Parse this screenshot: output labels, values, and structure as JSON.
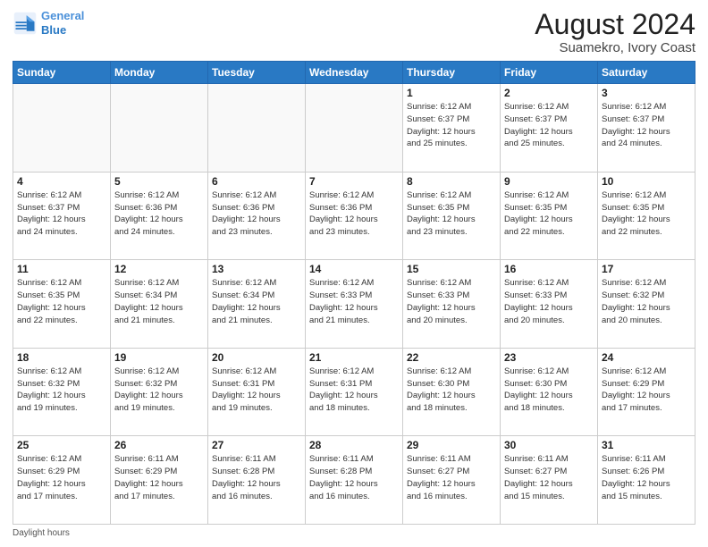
{
  "header": {
    "logo_line1": "General",
    "logo_line2": "Blue",
    "title": "August 2024",
    "subtitle": "Suamekro, Ivory Coast"
  },
  "days_of_week": [
    "Sunday",
    "Monday",
    "Tuesday",
    "Wednesday",
    "Thursday",
    "Friday",
    "Saturday"
  ],
  "weeks": [
    [
      {
        "day": "",
        "info": ""
      },
      {
        "day": "",
        "info": ""
      },
      {
        "day": "",
        "info": ""
      },
      {
        "day": "",
        "info": ""
      },
      {
        "day": "1",
        "info": "Sunrise: 6:12 AM\nSunset: 6:37 PM\nDaylight: 12 hours\nand 25 minutes."
      },
      {
        "day": "2",
        "info": "Sunrise: 6:12 AM\nSunset: 6:37 PM\nDaylight: 12 hours\nand 25 minutes."
      },
      {
        "day": "3",
        "info": "Sunrise: 6:12 AM\nSunset: 6:37 PM\nDaylight: 12 hours\nand 24 minutes."
      }
    ],
    [
      {
        "day": "4",
        "info": "Sunrise: 6:12 AM\nSunset: 6:37 PM\nDaylight: 12 hours\nand 24 minutes."
      },
      {
        "day": "5",
        "info": "Sunrise: 6:12 AM\nSunset: 6:36 PM\nDaylight: 12 hours\nand 24 minutes."
      },
      {
        "day": "6",
        "info": "Sunrise: 6:12 AM\nSunset: 6:36 PM\nDaylight: 12 hours\nand 23 minutes."
      },
      {
        "day": "7",
        "info": "Sunrise: 6:12 AM\nSunset: 6:36 PM\nDaylight: 12 hours\nand 23 minutes."
      },
      {
        "day": "8",
        "info": "Sunrise: 6:12 AM\nSunset: 6:35 PM\nDaylight: 12 hours\nand 23 minutes."
      },
      {
        "day": "9",
        "info": "Sunrise: 6:12 AM\nSunset: 6:35 PM\nDaylight: 12 hours\nand 22 minutes."
      },
      {
        "day": "10",
        "info": "Sunrise: 6:12 AM\nSunset: 6:35 PM\nDaylight: 12 hours\nand 22 minutes."
      }
    ],
    [
      {
        "day": "11",
        "info": "Sunrise: 6:12 AM\nSunset: 6:35 PM\nDaylight: 12 hours\nand 22 minutes."
      },
      {
        "day": "12",
        "info": "Sunrise: 6:12 AM\nSunset: 6:34 PM\nDaylight: 12 hours\nand 21 minutes."
      },
      {
        "day": "13",
        "info": "Sunrise: 6:12 AM\nSunset: 6:34 PM\nDaylight: 12 hours\nand 21 minutes."
      },
      {
        "day": "14",
        "info": "Sunrise: 6:12 AM\nSunset: 6:33 PM\nDaylight: 12 hours\nand 21 minutes."
      },
      {
        "day": "15",
        "info": "Sunrise: 6:12 AM\nSunset: 6:33 PM\nDaylight: 12 hours\nand 20 minutes."
      },
      {
        "day": "16",
        "info": "Sunrise: 6:12 AM\nSunset: 6:33 PM\nDaylight: 12 hours\nand 20 minutes."
      },
      {
        "day": "17",
        "info": "Sunrise: 6:12 AM\nSunset: 6:32 PM\nDaylight: 12 hours\nand 20 minutes."
      }
    ],
    [
      {
        "day": "18",
        "info": "Sunrise: 6:12 AM\nSunset: 6:32 PM\nDaylight: 12 hours\nand 19 minutes."
      },
      {
        "day": "19",
        "info": "Sunrise: 6:12 AM\nSunset: 6:32 PM\nDaylight: 12 hours\nand 19 minutes."
      },
      {
        "day": "20",
        "info": "Sunrise: 6:12 AM\nSunset: 6:31 PM\nDaylight: 12 hours\nand 19 minutes."
      },
      {
        "day": "21",
        "info": "Sunrise: 6:12 AM\nSunset: 6:31 PM\nDaylight: 12 hours\nand 18 minutes."
      },
      {
        "day": "22",
        "info": "Sunrise: 6:12 AM\nSunset: 6:30 PM\nDaylight: 12 hours\nand 18 minutes."
      },
      {
        "day": "23",
        "info": "Sunrise: 6:12 AM\nSunset: 6:30 PM\nDaylight: 12 hours\nand 18 minutes."
      },
      {
        "day": "24",
        "info": "Sunrise: 6:12 AM\nSunset: 6:29 PM\nDaylight: 12 hours\nand 17 minutes."
      }
    ],
    [
      {
        "day": "25",
        "info": "Sunrise: 6:12 AM\nSunset: 6:29 PM\nDaylight: 12 hours\nand 17 minutes."
      },
      {
        "day": "26",
        "info": "Sunrise: 6:11 AM\nSunset: 6:29 PM\nDaylight: 12 hours\nand 17 minutes."
      },
      {
        "day": "27",
        "info": "Sunrise: 6:11 AM\nSunset: 6:28 PM\nDaylight: 12 hours\nand 16 minutes."
      },
      {
        "day": "28",
        "info": "Sunrise: 6:11 AM\nSunset: 6:28 PM\nDaylight: 12 hours\nand 16 minutes."
      },
      {
        "day": "29",
        "info": "Sunrise: 6:11 AM\nSunset: 6:27 PM\nDaylight: 12 hours\nand 16 minutes."
      },
      {
        "day": "30",
        "info": "Sunrise: 6:11 AM\nSunset: 6:27 PM\nDaylight: 12 hours\nand 15 minutes."
      },
      {
        "day": "31",
        "info": "Sunrise: 6:11 AM\nSunset: 6:26 PM\nDaylight: 12 hours\nand 15 minutes."
      }
    ]
  ],
  "footer": "Daylight hours"
}
